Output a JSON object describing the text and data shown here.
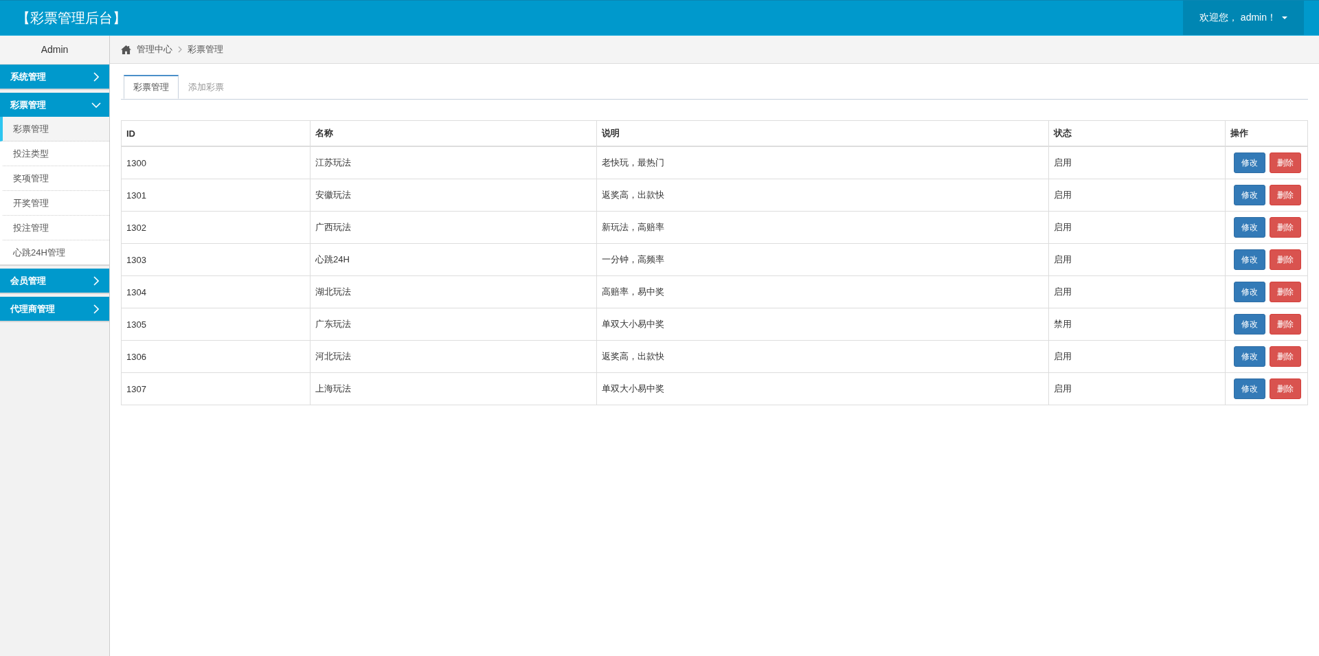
{
  "header": {
    "title": "【彩票管理后台】",
    "user_menu": "欢迎您， admin！"
  },
  "sidebar": {
    "user": "Admin",
    "groups": [
      {
        "label": "系统管理",
        "expanded": false
      },
      {
        "label": "彩票管理",
        "expanded": true,
        "items": [
          {
            "label": "彩票管理",
            "selected": true
          },
          {
            "label": "投注类型",
            "selected": false
          },
          {
            "label": "奖项管理",
            "selected": false
          },
          {
            "label": "开奖管理",
            "selected": false
          },
          {
            "label": "投注管理",
            "selected": false
          },
          {
            "label": "心跳24H管理",
            "selected": false
          }
        ]
      },
      {
        "label": "会员管理",
        "expanded": false
      },
      {
        "label": "代理商管理",
        "expanded": false
      }
    ]
  },
  "breadcrumb": [
    "管理中心",
    "彩票管理"
  ],
  "tabs": [
    {
      "label": "彩票管理",
      "selected": true
    },
    {
      "label": "添加彩票",
      "selected": false
    }
  ],
  "table": {
    "columns": [
      "ID",
      "名称",
      "说明",
      "状态",
      "操作"
    ],
    "rows": [
      {
        "cells": [
          "1300",
          "江苏玩法",
          "老快玩，最热门",
          "启用"
        ],
        "actions": [
          {
            "kind": "edit",
            "label": "修改"
          },
          {
            "kind": "delete",
            "label": "删除"
          }
        ]
      },
      {
        "cells": [
          "1301",
          "安徽玩法",
          "返奖高，出款快",
          "启用"
        ],
        "actions": [
          {
            "kind": "edit",
            "label": "修改"
          },
          {
            "kind": "delete",
            "label": "删除"
          }
        ]
      },
      {
        "cells": [
          "1302",
          "广西玩法",
          "新玩法，高赔率",
          "启用"
        ],
        "actions": [
          {
            "kind": "edit",
            "label": "修改"
          },
          {
            "kind": "delete",
            "label": "删除"
          }
        ]
      },
      {
        "cells": [
          "1303",
          "心跳24H",
          "一分钟，高频率",
          "启用"
        ],
        "actions": [
          {
            "kind": "edit",
            "label": "修改"
          },
          {
            "kind": "delete",
            "label": "删除"
          }
        ]
      },
      {
        "cells": [
          "1304",
          "湖北玩法",
          "高赔率，易中奖",
          "启用"
        ],
        "actions": [
          {
            "kind": "edit",
            "label": "修改"
          },
          {
            "kind": "delete",
            "label": "删除"
          }
        ]
      },
      {
        "cells": [
          "1305",
          "广东玩法",
          "单双大小易中奖",
          "禁用"
        ],
        "actions": [
          {
            "kind": "edit",
            "label": "修改"
          },
          {
            "kind": "delete",
            "label": "删除"
          }
        ]
      },
      {
        "cells": [
          "1306",
          "河北玩法",
          "返奖高，出款快",
          "启用"
        ],
        "actions": [
          {
            "kind": "edit",
            "label": "修改"
          },
          {
            "kind": "delete",
            "label": "删除"
          }
        ]
      },
      {
        "cells": [
          "1307",
          "上海玩法",
          "单双大小易中奖",
          "启用"
        ],
        "actions": [
          {
            "kind": "edit",
            "label": "修改"
          },
          {
            "kind": "delete",
            "label": "删除"
          }
        ]
      }
    ]
  }
}
